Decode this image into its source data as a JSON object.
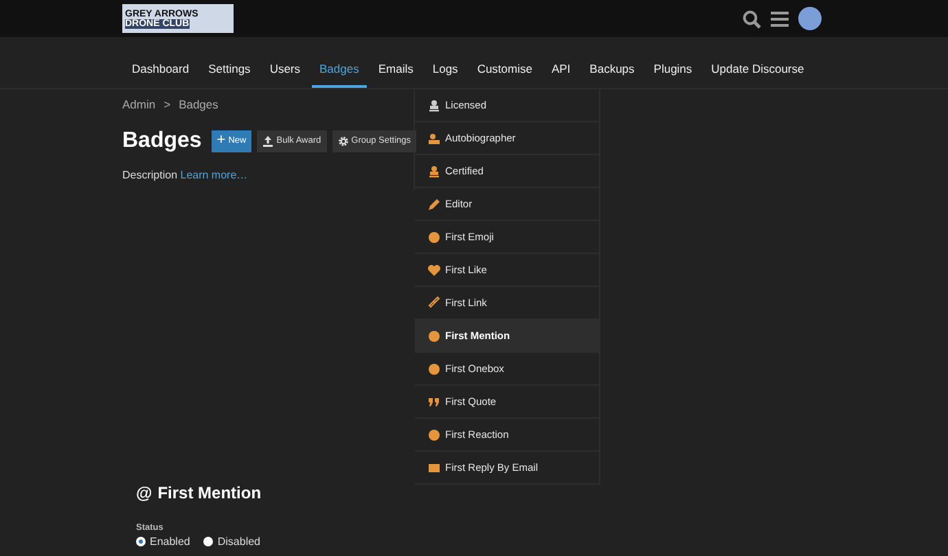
{
  "header": {
    "logo_line_1": "GREY ARROWS",
    "logo_line_2": "DRONE CLUB"
  },
  "nav": [
    {
      "label": "Dashboard",
      "selected": false
    },
    {
      "label": "Settings",
      "selected": false
    },
    {
      "label": "Users",
      "selected": false
    },
    {
      "label": "Badges",
      "selected": true
    },
    {
      "label": "Emails",
      "selected": false
    },
    {
      "label": "Logs",
      "selected": false
    },
    {
      "label": "Customise",
      "selected": false
    },
    {
      "label": "API",
      "selected": false
    },
    {
      "label": "Backups",
      "selected": false
    },
    {
      "label": "Plugins",
      "selected": false
    },
    {
      "label": "Update Discourse",
      "selected": false
    }
  ],
  "breadcrumb": [
    "Admin",
    ">",
    "Badges"
  ],
  "title": "Badges",
  "buttons": [
    {
      "kind": "primary",
      "label": "New",
      "icon": "+"
    },
    {
      "kind": "secondary",
      "label": "Bulk Award"
    },
    {
      "kind": "secondary",
      "label": "Group Settings"
    }
  ],
  "description": {
    "label": "Description",
    "link": "Learn more…"
  },
  "badges": [
    {
      "name": "Licensed",
      "color": "#cccccc",
      "selected": false
    },
    {
      "name": "Autobiographer",
      "color": "#e5953b",
      "selected": false
    },
    {
      "name": "Certified",
      "color": "#e5953b",
      "selected": false
    },
    {
      "name": "Editor",
      "color": "#e5953b",
      "selected": false
    },
    {
      "name": "First Emoji",
      "color": "#e5953b",
      "selected": false
    },
    {
      "name": "First Like",
      "color": "#e5953b",
      "selected": false
    },
    {
      "name": "First Link",
      "color": "#e5953b",
      "selected": false
    },
    {
      "name": "First Mention",
      "color": "#e5953b",
      "selected": true
    },
    {
      "name": "First Onebox",
      "color": "#e5953b",
      "selected": false
    },
    {
      "name": "First Quote",
      "color": "#e5953b",
      "selected": false
    },
    {
      "name": "First Reaction",
      "color": "#e5953b",
      "selected": false
    },
    {
      "name": "First Reply By Email",
      "color": "#e5953b",
      "selected": false
    }
  ],
  "detail": {
    "title_icon": "@",
    "title": "First Mention",
    "status_label": "Status",
    "status_options": [
      {
        "label": "Enabled",
        "selected": true
      },
      {
        "label": "Disabled",
        "selected": false
      }
    ]
  }
}
